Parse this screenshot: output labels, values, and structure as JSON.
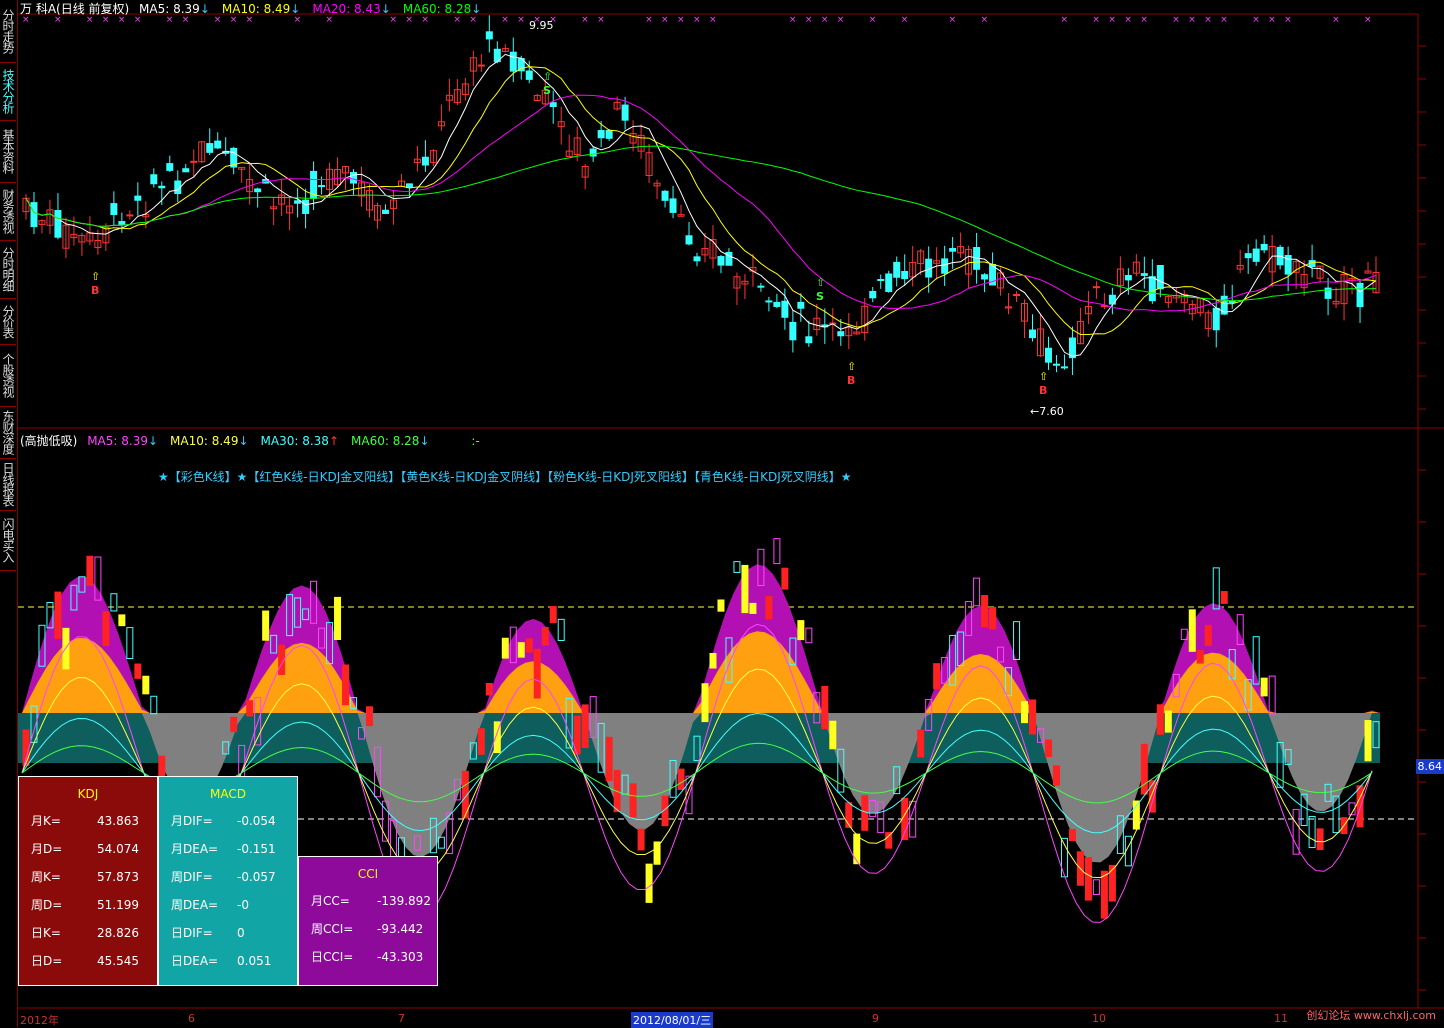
{
  "sidebar": {
    "tabs": [
      {
        "label": "分时走势",
        "active": false
      },
      {
        "label": "技术分析",
        "active": true
      },
      {
        "label": "基本资料",
        "active": false
      },
      {
        "label": "财务透视",
        "active": false
      },
      {
        "label": "分时明细",
        "active": false
      },
      {
        "label": "分价表",
        "active": false
      },
      {
        "label": "个股透视",
        "active": false
      },
      {
        "label": "东财深度",
        "active": false
      },
      {
        "label": "日线报表",
        "active": false
      },
      {
        "label": "闪电买入",
        "active": false
      }
    ]
  },
  "main": {
    "title": "万 科A(日线 前复权)",
    "ma": [
      {
        "label": "MA5: 8.39",
        "arrow": "↓",
        "color": "#ffffff"
      },
      {
        "label": "MA10: 8.49",
        "arrow": "↓",
        "color": "#ffff00"
      },
      {
        "label": "MA20: 8.43",
        "arrow": "↓",
        "color": "#ff00ff"
      },
      {
        "label": "MA60: 8.28",
        "arrow": "↓",
        "color": "#00ff00"
      }
    ],
    "high_label": "9.95",
    "low_label": "←7.60",
    "signals": [
      "B",
      "S",
      "B",
      "B",
      "S"
    ]
  },
  "indicator": {
    "title": "(高抛低吸)",
    "ma": [
      {
        "label": "MA5: 8.39",
        "arrow": "↓",
        "color": "#ff44ff"
      },
      {
        "label": "MA10: 8.49",
        "arrow": "↓",
        "color": "#ffff44"
      },
      {
        "label": "MA30: 8.38",
        "arrow": "↑",
        "color": "#44ffff"
      },
      {
        "label": "MA60: 8.28",
        "arrow": "↓",
        "color": "#44ff44"
      }
    ],
    "extra": ":-",
    "description": "★【彩色K线】★【红色K线-日KDJ金叉阳线】【黄色K线-日KDJ金叉阴线】【粉色K线-日KDJ死叉阳线】【青色K线-日KDJ死叉阴线】★"
  },
  "panels": {
    "kdj": {
      "title": "KDJ",
      "rows": [
        {
          "k": "月K=",
          "v": "43.863"
        },
        {
          "k": "月D=",
          "v": "54.074"
        },
        {
          "k": "周K=",
          "v": "57.873"
        },
        {
          "k": "周D=",
          "v": "51.199"
        },
        {
          "k": "日K=",
          "v": "28.826"
        },
        {
          "k": "日D=",
          "v": "45.545"
        }
      ]
    },
    "macd": {
      "title": "MACD",
      "rows": [
        {
          "k": "月DIF=",
          "v": "-0.054"
        },
        {
          "k": "月DEA=",
          "v": "-0.151"
        },
        {
          "k": "周DIF=",
          "v": "-0.057"
        },
        {
          "k": "周DEA=",
          "v": "-0"
        },
        {
          "k": "日DIF=",
          "v": "0"
        },
        {
          "k": "日DEA=",
          "v": "0.051"
        }
      ]
    },
    "cci": {
      "title": "CCI",
      "rows": [
        {
          "k": "月CC=",
          "v": "-139.892"
        },
        {
          "k": "周CCI=",
          "v": "-93.442"
        },
        {
          "k": "日CCI=",
          "v": "-43.303"
        }
      ]
    }
  },
  "xaxis": {
    "ticks": [
      "2012年",
      "6",
      "7",
      "9",
      "10",
      "11"
    ],
    "cursor_date": "2012/08/01/三"
  },
  "price_tag": "8.64",
  "watermark": "创幻论坛 www.chxlj.com",
  "colors": {
    "up": "#ff3333",
    "down": "#33ffff",
    "background": "#000000",
    "grid": "#8a0000"
  }
}
